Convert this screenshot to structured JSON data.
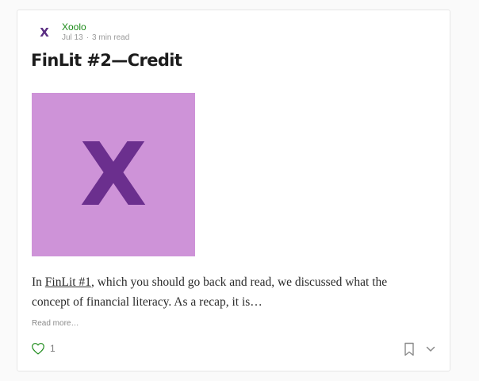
{
  "colors": {
    "accent_green": "#1a8917",
    "brand_purple": "#5a2d82",
    "hero_background": "#ce93d8",
    "hero_letter": "#6b2f8e"
  },
  "post": {
    "author": {
      "name": "Xoolo",
      "avatar_letter": "X"
    },
    "date": "Jul 13",
    "separator": "·",
    "read_time": "3 min read",
    "title": "FinLit #2—Credit",
    "hero_image": {
      "letter": "X"
    },
    "excerpt": {
      "before_link": "In ",
      "link_text": "FinLit #1",
      "after_link": ", which you should go back and read, we discussed what the concept of financial literacy. As a recap, it is…"
    },
    "read_more": "Read more…",
    "claps": "1"
  },
  "icons": {
    "clap": "heart-icon",
    "bookmark": "bookmark-icon",
    "more": "chevron-down-icon"
  }
}
